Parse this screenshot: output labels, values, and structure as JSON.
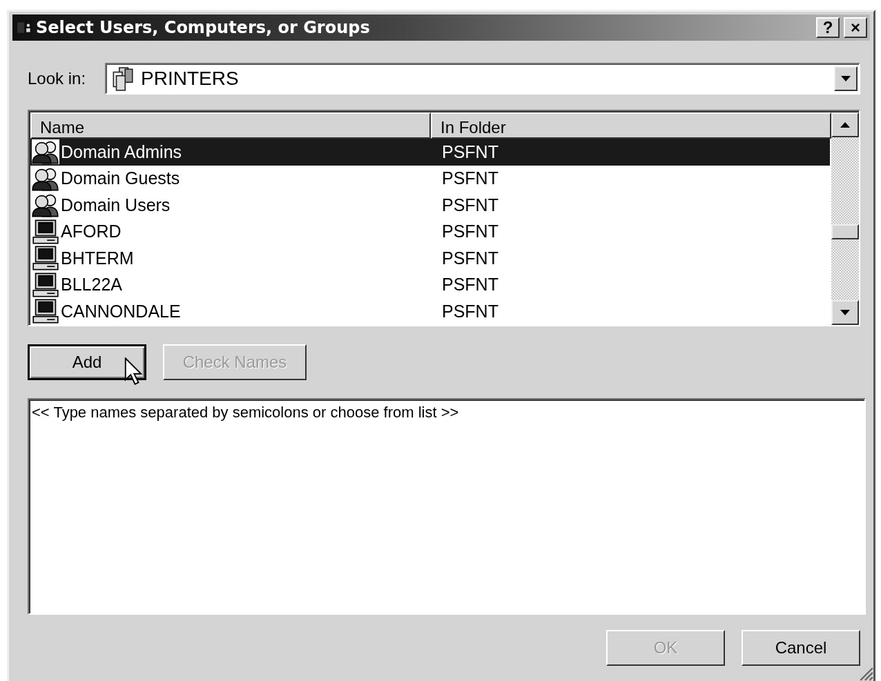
{
  "window": {
    "title": "Select Users, Computers, or Groups",
    "help": "?",
    "close": "×"
  },
  "look_in": {
    "label": "Look in:",
    "value": "PRINTERS"
  },
  "list": {
    "columns": [
      "Name",
      "In Folder"
    ],
    "rows": [
      {
        "name": "Domain Admins",
        "folder": "PSFNT",
        "kind": "group",
        "selected": true
      },
      {
        "name": "Domain Guests",
        "folder": "PSFNT",
        "kind": "group",
        "selected": false
      },
      {
        "name": "Domain Users",
        "folder": "PSFNT",
        "kind": "group",
        "selected": false
      },
      {
        "name": "AFORD",
        "folder": "PSFNT",
        "kind": "computer",
        "selected": false
      },
      {
        "name": "BHTERM",
        "folder": "PSFNT",
        "kind": "computer",
        "selected": false
      },
      {
        "name": "BLL22A",
        "folder": "PSFNT",
        "kind": "computer",
        "selected": false
      },
      {
        "name": "CANNONDALE",
        "folder": "PSFNT",
        "kind": "computer",
        "selected": false
      }
    ]
  },
  "actions": [
    {
      "label": "Add",
      "disabled": false,
      "default": true
    },
    {
      "label": "Check Names",
      "disabled": true,
      "default": false
    }
  ],
  "names_box": {
    "value": "<< Type names separated by semicolons or choose from list >>"
  },
  "dialog_buttons": [
    {
      "label": "OK",
      "disabled": true,
      "default": false
    },
    {
      "label": "Cancel",
      "disabled": false,
      "default": false
    }
  ]
}
